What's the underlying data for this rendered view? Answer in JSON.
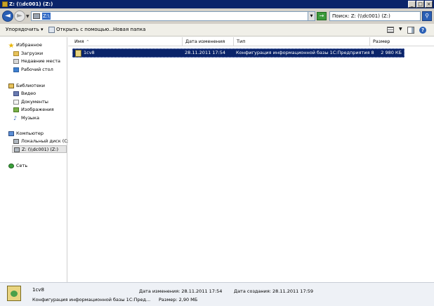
{
  "window": {
    "title": "Z: (\\\\dc001) (Z:)"
  },
  "address": {
    "value": "Z:\\"
  },
  "search": {
    "text": "Поиск: Z: (\\\\dc001) (Z:)"
  },
  "toolbar": {
    "organize": "Упорядочить",
    "open_with": "Открыть с помощью...",
    "new_folder": "Новая папка"
  },
  "nav": {
    "favorites": {
      "label": "Избранное",
      "items": [
        "Загрузки",
        "Недавние места",
        "Рабочий стол"
      ]
    },
    "libraries": {
      "label": "Библиотеки",
      "items": [
        "Видео",
        "Документы",
        "Изображения",
        "Музыка"
      ]
    },
    "computer": {
      "label": "Компьютер",
      "items": [
        "Локальный диск (C:)",
        "Z: (\\\\dc001) (Z:)"
      ]
    },
    "network": {
      "label": "Сеть"
    }
  },
  "columns": {
    "name": "Имя",
    "date": "Дата изменения",
    "type": "Тип",
    "size": "Размер"
  },
  "files": [
    {
      "name": "1cv8",
      "date": "28.11.2011 17:54",
      "type": "Конфигурация информационной базы 1С:Предприятия 8",
      "size": "2 980 КБ"
    }
  ],
  "details": {
    "name": "1cv8",
    "type": "Конфигурация информационной базы 1С:Пред...",
    "modified": "Дата изменения: 28.11.2011 17:54",
    "size": "Размер: 2,90 МБ",
    "created": "Дата создания: 28.11.2011 17:59"
  }
}
